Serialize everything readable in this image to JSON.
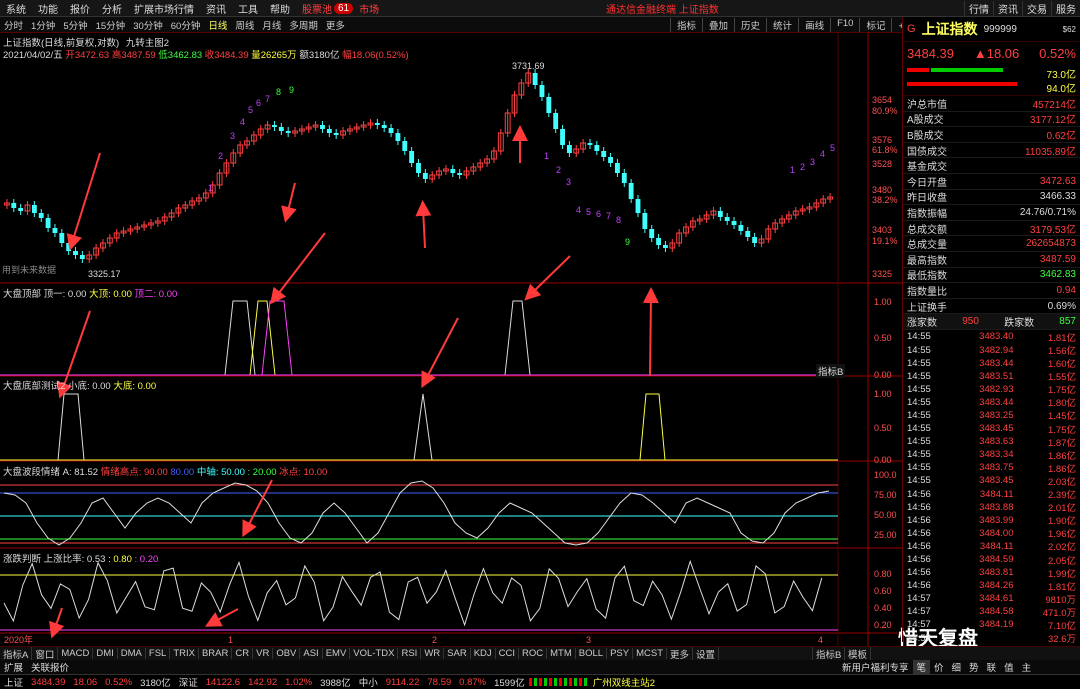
{
  "menu": {
    "items": [
      "系统",
      "功能",
      "报价",
      "分析",
      "扩展市场行情",
      "资讯",
      "工具",
      "帮助"
    ],
    "stock_pool": "股票池",
    "badge": "61",
    "market": "市场",
    "center": "通达信金融终端   上证指数",
    "right": [
      "行情",
      "资讯",
      "交易",
      "服务"
    ]
  },
  "period": {
    "items": [
      "分时",
      "1分钟",
      "5分钟",
      "15分钟",
      "30分钟",
      "60分钟",
      "日线",
      "周线",
      "月线",
      "多周期",
      "更多"
    ],
    "selected": "日线",
    "tools": [
      "指标",
      "叠加",
      "历史",
      "统计",
      "画线",
      "F10",
      "标记",
      "+自选",
      "返回"
    ]
  },
  "chart": {
    "title": "上证指数(日线,前复权,对数)",
    "title_link": "九转主图2",
    "date": "2021/04/02/五",
    "open": "开3472.63",
    "high": "高3487.59",
    "low": "低3462.83",
    "close": "收3484.39",
    "vol": "量26265万",
    "amt": "额3180亿",
    "chg": "幅18.06(0.52%)",
    "high_label": "3731.69",
    "low_label": "3325.17",
    "hint": "用到未来数据",
    "price_ticks": [
      "3654",
      "80.9%",
      "3576",
      "61.8%",
      "3528",
      "3480",
      "38.2%",
      "3403",
      "19.1%",
      "3325"
    ],
    "dates": [
      "2020年",
      "1",
      "2",
      "3",
      "4"
    ],
    "seq_top": [
      "1",
      "2",
      "3",
      "4",
      "5",
      "6",
      "7",
      "8",
      "9"
    ],
    "seq_mid": [
      "1",
      "2",
      "3",
      "4",
      "5",
      "6",
      "7",
      "8",
      "9"
    ],
    "seq_right": [
      "1",
      "2",
      "3",
      "4",
      "5"
    ]
  },
  "pane1": {
    "name": "大盘顶部",
    "l1": "顶一: 0.00",
    "l2": "大顶: 0.00",
    "l3": "顶二: 0.00",
    "ticks": [
      "1.00",
      "0.50",
      "0.00"
    ]
  },
  "pane2": {
    "name": "大盘底部测试2",
    "l1": "小底: 0.00",
    "l2": "大底: 0.00",
    "ticks": [
      "1.00",
      "0.50",
      "0.00"
    ],
    "tag": "指标B"
  },
  "pane3": {
    "name": "大盘波段情绪",
    "l1": "A: 81.52",
    "l2": "情绪高点: 90.00",
    "l3": "80.00",
    "l4": "中轴: 50.00",
    "l5": ": 20.00",
    "l6": "冰点: 10.00",
    "ticks": [
      "100.0",
      "75.00",
      "50.00",
      "25.00"
    ]
  },
  "pane4": {
    "name": "涨跌判断",
    "l1": "上涨比率: 0.53",
    "l2": ": 0.80",
    "l3": ": 0.20",
    "ticks": [
      "0.80",
      "0.60",
      "0.40",
      "0.20"
    ]
  },
  "right": {
    "header": {
      "code_prefix": "G",
      "name": "上证指数",
      "code": "999999",
      "sub": "$62"
    },
    "quote": {
      "price": "3484.39",
      "chg": "▲18.06",
      "pct": "0.52%"
    },
    "bars": [
      "73.0亿",
      "94.0亿"
    ],
    "rows": [
      [
        "沪总市值",
        "457214亿"
      ],
      [
        "A股成交",
        "3177.12亿"
      ],
      [
        "B股成交",
        "0.62亿"
      ],
      [
        "国债成交",
        "11035.89亿"
      ],
      [
        "基金成交",
        ""
      ],
      [
        "今日开盘",
        "3472.63"
      ],
      [
        "昨日收盘",
        "3466.33"
      ],
      [
        "指数振幅",
        "24.76/0.71%"
      ],
      [
        "总成交额",
        "3179.53亿"
      ],
      [
        "总成交量",
        "262654873"
      ],
      [
        "最高指数",
        "3487.59"
      ],
      [
        "最低指数",
        "3462.83"
      ],
      [
        "指数量比",
        "0.94"
      ],
      [
        "上证换手",
        "0.69%"
      ]
    ],
    "updown": {
      "up_label": "涨家数",
      "up": "950",
      "down_label": "跌家数",
      "down": "857"
    },
    "ticks": [
      [
        "14:55",
        "3483.40",
        "1.81亿"
      ],
      [
        "14:55",
        "3482.94",
        "1.56亿"
      ],
      [
        "14:55",
        "3483.44",
        "1.60亿"
      ],
      [
        "14:55",
        "3483.51",
        "1.55亿"
      ],
      [
        "14:55",
        "3482.93",
        "1.75亿"
      ],
      [
        "14:55",
        "3483.44",
        "1.80亿"
      ],
      [
        "14:55",
        "3483.25",
        "1.45亿"
      ],
      [
        "14:55",
        "3483.45",
        "1.75亿"
      ],
      [
        "14:55",
        "3483.63",
        "1.87亿"
      ],
      [
        "14:55",
        "3483.34",
        "1.86亿"
      ],
      [
        "14:55",
        "3483.75",
        "1.86亿"
      ],
      [
        "14:55",
        "3483.45",
        "2.03亿"
      ],
      [
        "14:56",
        "3484.11",
        "2.39亿"
      ],
      [
        "14:56",
        "3483.88",
        "2.01亿"
      ],
      [
        "14:56",
        "3483.99",
        "1.90亿"
      ],
      [
        "14:56",
        "3484.00",
        "1.96亿"
      ],
      [
        "14:56",
        "3484.11",
        "2.02亿"
      ],
      [
        "14:56",
        "3484.59",
        "2.05亿"
      ],
      [
        "14:56",
        "3483.81",
        "1.99亿"
      ],
      [
        "14:56",
        "3484.26",
        "1.81亿"
      ],
      [
        "14:57",
        "3484.61",
        "9810万"
      ],
      [
        "14:57",
        "3484.58",
        "471.0万"
      ],
      [
        "14:57",
        "3484.19",
        "7.10亿"
      ],
      [
        "14:57",
        "",
        "32.6万"
      ],
      [
        "",
        "",
        "8588万"
      ]
    ]
  },
  "indicator_tabs": [
    "指标A",
    "窗口",
    "MACD",
    "DMI",
    "DMA",
    "FSL",
    "TRIX",
    "BRAR",
    "CR",
    "VR",
    "OBV",
    "ASI",
    "EMV",
    "VOL-TDX",
    "RSI",
    "WR",
    "SAR",
    "KDJ",
    "CCI",
    "ROC",
    "MTM",
    "BOLL",
    "PSY",
    "MCST",
    "更多",
    "设置"
  ],
  "tabs_right": [
    "指标B",
    "模板"
  ],
  "bottom2_left": [
    "扩展",
    "关联报价"
  ],
  "bottom2_right": [
    "新用户福利专享",
    "笔",
    "价",
    "细",
    "势",
    "联",
    "值",
    "主"
  ],
  "status": {
    "sh_label": "上证",
    "sh_price": "3484.39",
    "sh_chg": "18.06",
    "sh_pct": "0.52%",
    "sh_amt": "3180亿",
    "sz_label": "深证",
    "sz_price": "14122.6",
    "sz_chg": "142.92",
    "sz_pct": "1.02%",
    "sz_amt": "3988亿",
    "zx_label": "中小",
    "zx_price": "9114.22",
    "zx_chg": "78.59",
    "zx_pct": "0.87%",
    "zx_amt": "1599亿",
    "station": "广州双线主站2"
  },
  "watermark": "惜天复盘",
  "colors": {
    "up": "#ff4040",
    "down": "#40ffff",
    "bg": "#000000"
  }
}
